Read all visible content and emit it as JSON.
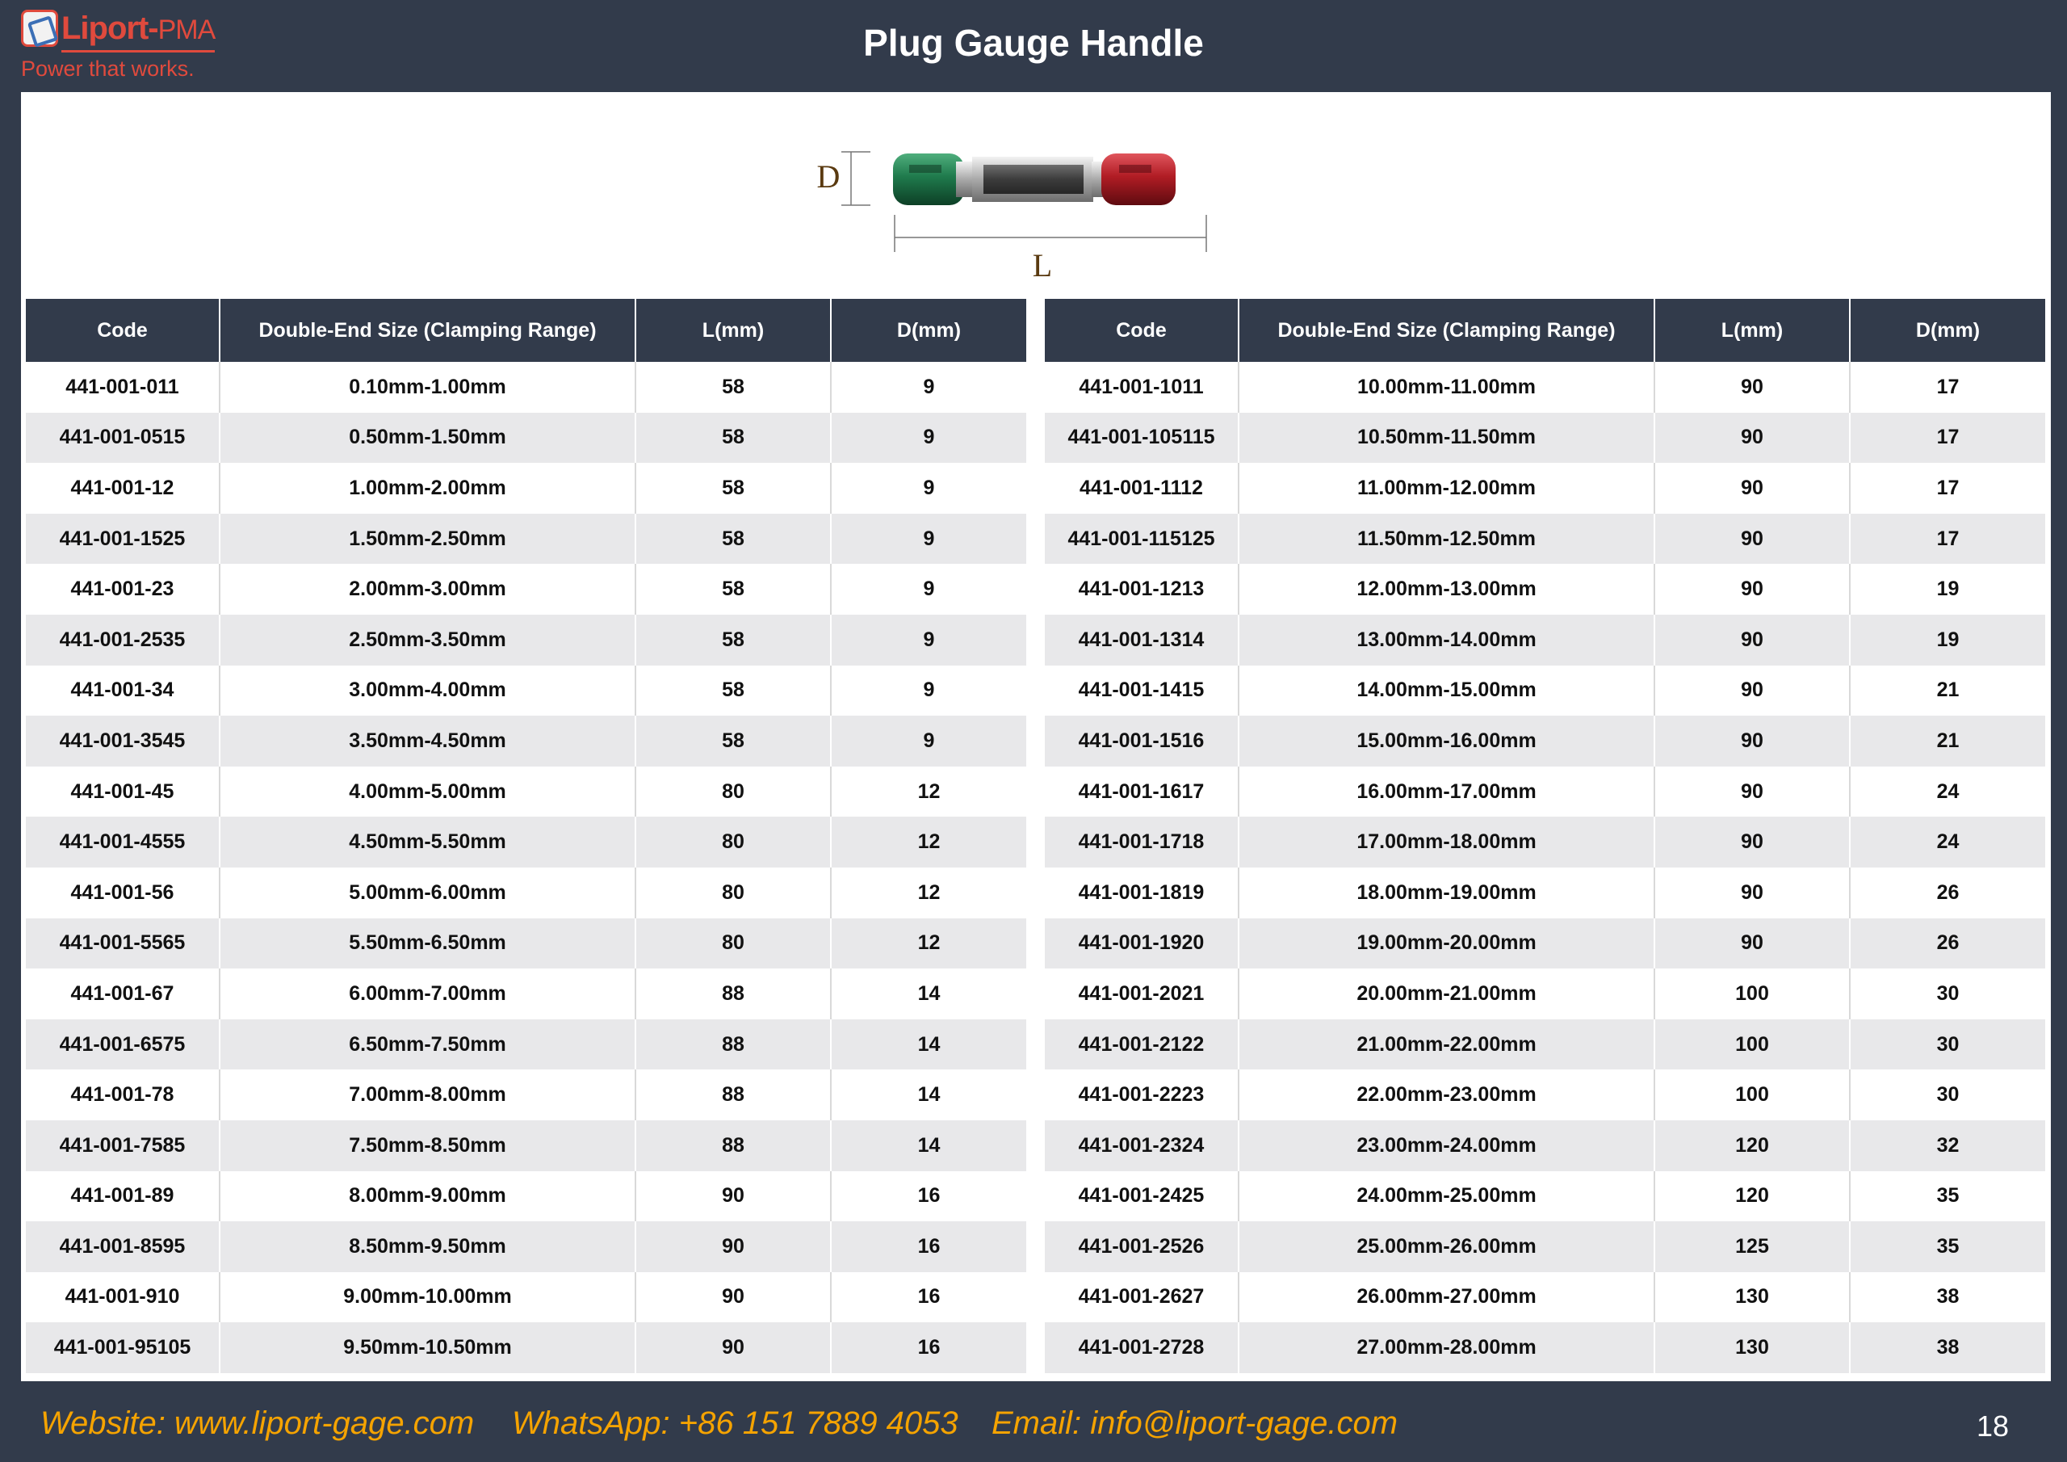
{
  "header": {
    "logo_name": "Liport-",
    "logo_suffix": "PMA",
    "slogan": "Power that works.",
    "title": "Plug Gauge Handle"
  },
  "diagram": {
    "label_d": "D",
    "label_l": "L"
  },
  "columns": [
    "Code",
    "Double-End Size (Clamping Range)",
    "L(mm)",
    "D(mm)"
  ],
  "left_rows": [
    [
      "441-001-011",
      "0.10mm-1.00mm",
      "58",
      "9"
    ],
    [
      "441-001-0515",
      "0.50mm-1.50mm",
      "58",
      "9"
    ],
    [
      "441-001-12",
      "1.00mm-2.00mm",
      "58",
      "9"
    ],
    [
      "441-001-1525",
      "1.50mm-2.50mm",
      "58",
      "9"
    ],
    [
      "441-001-23",
      "2.00mm-3.00mm",
      "58",
      "9"
    ],
    [
      "441-001-2535",
      "2.50mm-3.50mm",
      "58",
      "9"
    ],
    [
      "441-001-34",
      "3.00mm-4.00mm",
      "58",
      "9"
    ],
    [
      "441-001-3545",
      "3.50mm-4.50mm",
      "58",
      "9"
    ],
    [
      "441-001-45",
      "4.00mm-5.00mm",
      "80",
      "12"
    ],
    [
      "441-001-4555",
      "4.50mm-5.50mm",
      "80",
      "12"
    ],
    [
      "441-001-56",
      "5.00mm-6.00mm",
      "80",
      "12"
    ],
    [
      "441-001-5565",
      "5.50mm-6.50mm",
      "80",
      "12"
    ],
    [
      "441-001-67",
      "6.00mm-7.00mm",
      "88",
      "14"
    ],
    [
      "441-001-6575",
      "6.50mm-7.50mm",
      "88",
      "14"
    ],
    [
      "441-001-78",
      "7.00mm-8.00mm",
      "88",
      "14"
    ],
    [
      "441-001-7585",
      "7.50mm-8.50mm",
      "88",
      "14"
    ],
    [
      "441-001-89",
      "8.00mm-9.00mm",
      "90",
      "16"
    ],
    [
      "441-001-8595",
      "8.50mm-9.50mm",
      "90",
      "16"
    ],
    [
      "441-001-910",
      "9.00mm-10.00mm",
      "90",
      "16"
    ],
    [
      "441-001-95105",
      "9.50mm-10.50mm",
      "90",
      "16"
    ]
  ],
  "right_rows": [
    [
      "441-001-1011",
      "10.00mm-11.00mm",
      "90",
      "17"
    ],
    [
      "441-001-105115",
      "10.50mm-11.50mm",
      "90",
      "17"
    ],
    [
      "441-001-1112",
      "11.00mm-12.00mm",
      "90",
      "17"
    ],
    [
      "441-001-115125",
      "11.50mm-12.50mm",
      "90",
      "17"
    ],
    [
      "441-001-1213",
      "12.00mm-13.00mm",
      "90",
      "19"
    ],
    [
      "441-001-1314",
      "13.00mm-14.00mm",
      "90",
      "19"
    ],
    [
      "441-001-1415",
      "14.00mm-15.00mm",
      "90",
      "21"
    ],
    [
      "441-001-1516",
      "15.00mm-16.00mm",
      "90",
      "21"
    ],
    [
      "441-001-1617",
      "16.00mm-17.00mm",
      "90",
      "24"
    ],
    [
      "441-001-1718",
      "17.00mm-18.00mm",
      "90",
      "24"
    ],
    [
      "441-001-1819",
      "18.00mm-19.00mm",
      "90",
      "26"
    ],
    [
      "441-001-1920",
      "19.00mm-20.00mm",
      "90",
      "26"
    ],
    [
      "441-001-2021",
      "20.00mm-21.00mm",
      "100",
      "30"
    ],
    [
      "441-001-2122",
      "21.00mm-22.00mm",
      "100",
      "30"
    ],
    [
      "441-001-2223",
      "22.00mm-23.00mm",
      "100",
      "30"
    ],
    [
      "441-001-2324",
      "23.00mm-24.00mm",
      "120",
      "32"
    ],
    [
      "441-001-2425",
      "24.00mm-25.00mm",
      "120",
      "35"
    ],
    [
      "441-001-2526",
      "25.00mm-26.00mm",
      "125",
      "35"
    ],
    [
      "441-001-2627",
      "26.00mm-27.00mm",
      "130",
      "38"
    ],
    [
      "441-001-2728",
      "27.00mm-28.00mm",
      "130",
      "38"
    ]
  ],
  "footer": {
    "website": "Website: www.liport-gage.com",
    "whatsapp": "WhatsApp: +86 151 7889 4053",
    "email": "Email: info@liport-gage.com",
    "page_number": "18"
  },
  "colors": {
    "background": "#323b4b",
    "brand_red": "#e04a3d",
    "footer_text": "#f5a300",
    "gauge_green": "#1f7a4c",
    "gauge_red": "#b01c24"
  }
}
